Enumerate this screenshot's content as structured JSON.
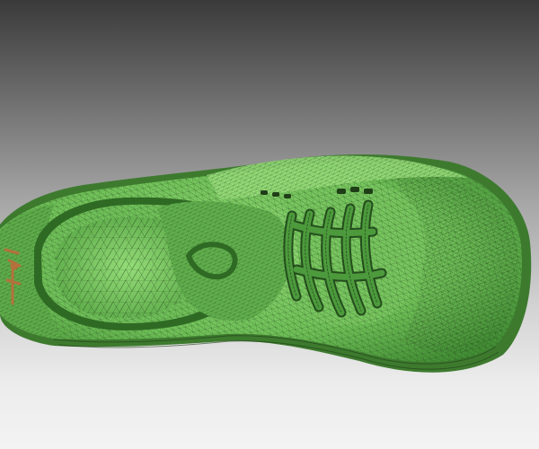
{
  "scene": {
    "subject": "sneaker-wireframe-mesh",
    "view": "top",
    "colors": {
      "background_top": "#3a3a3a",
      "background_bottom": "#f3f3f3",
      "mesh_fill": "#6fc058",
      "mesh_fill_light": "#8fd873",
      "mesh_fill_dark": "#3f8a32",
      "wire": "#1f3d17",
      "lace": "#4c9a3c",
      "lace_dark": "#244d1c",
      "accent_logo": "#b5703c"
    }
  }
}
